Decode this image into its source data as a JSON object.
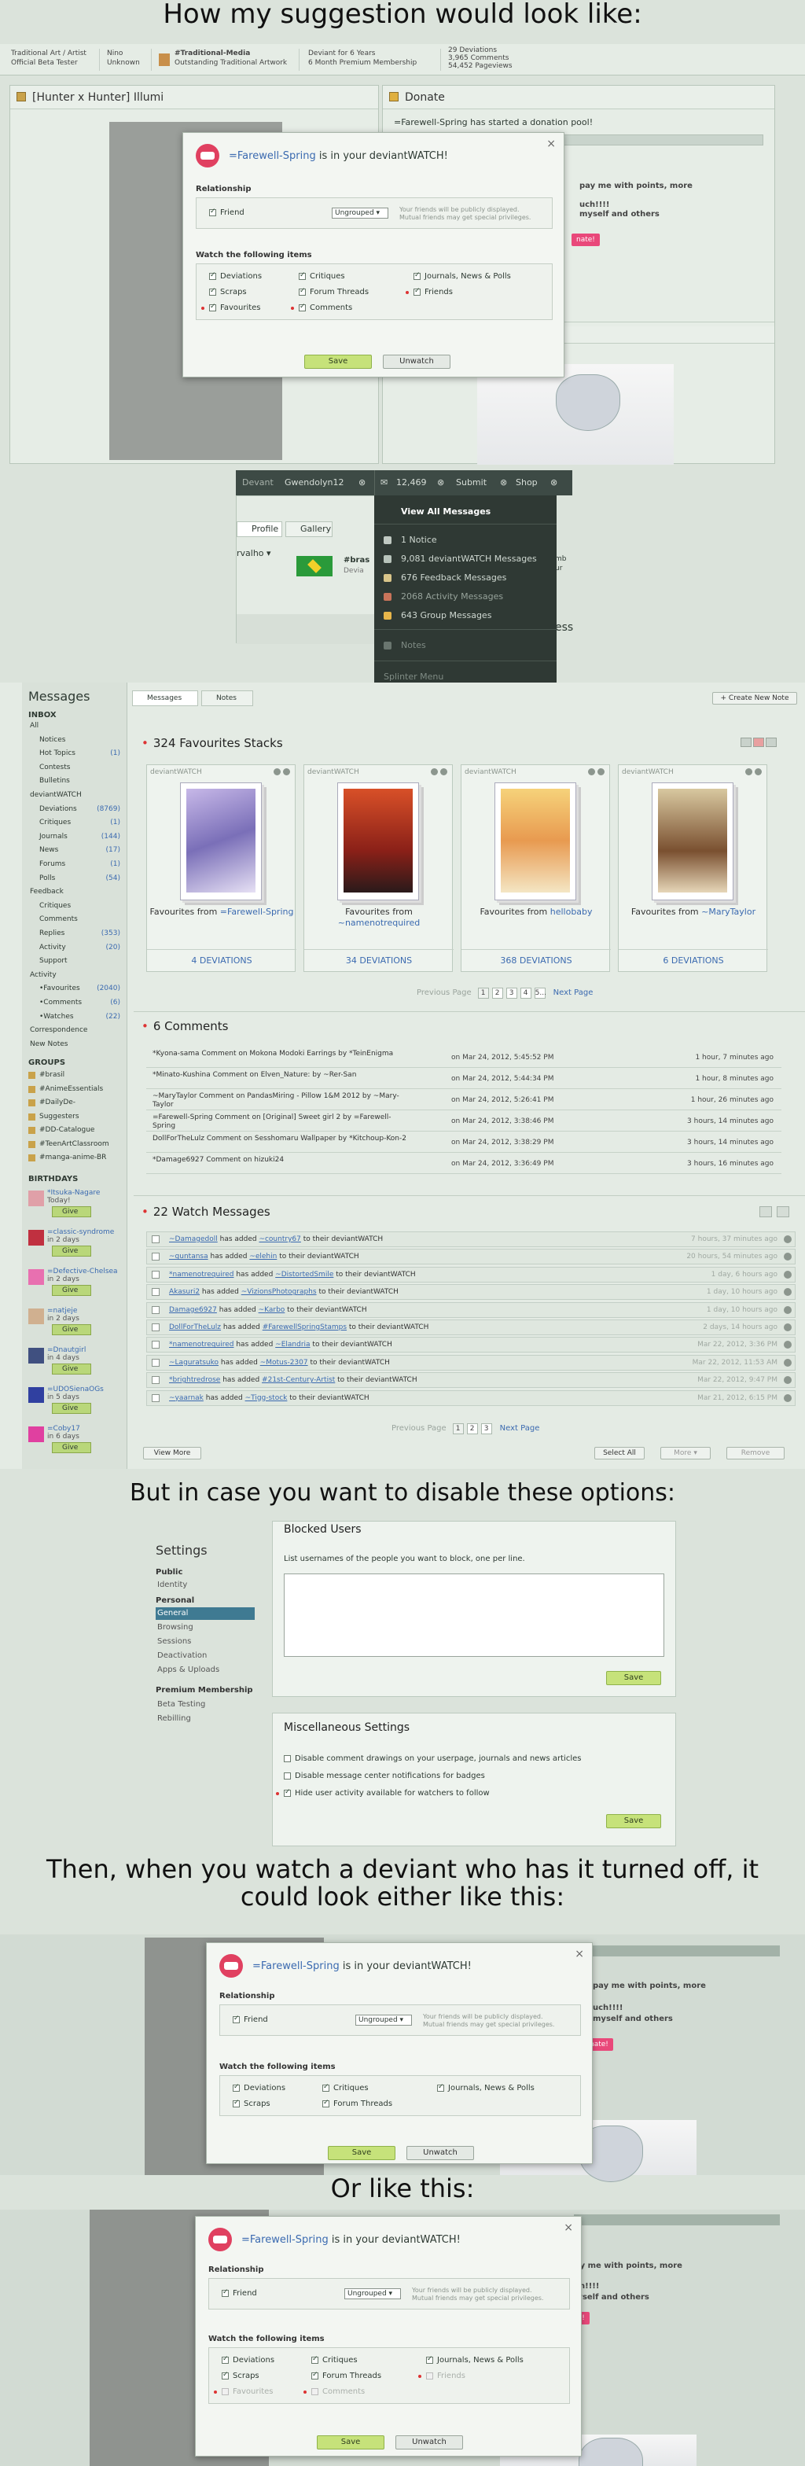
{
  "captions": {
    "c1": "How my suggestion would look  like:",
    "c2": "But in case you want to disable these options:",
    "c3": "Then, when you watch a deviant who has it turned off, it could look either like this:",
    "c4": "Or like this:"
  },
  "topbar": {
    "c1a": "Traditional Art / Artist",
    "c1b": "Official Beta Tester",
    "c2a": "Nino",
    "c2b": "Unknown",
    "c3a": "#Traditional-Media",
    "c3b": "Outstanding Traditional Artwork",
    "c4a": "Deviant for 6 Years",
    "c4b": "6 Month Premium Membership",
    "c5a": "29 Deviations",
    "c5b": "3,965 Comments",
    "c5c": "54,452 Pageviews"
  },
  "left_panel_title": "[Hunter x Hunter] Illumi",
  "donate": {
    "title": "Donate",
    "started": "=Farewell-Spring has started a donation pool!",
    "pay": "pay me with points, more",
    "chlt": "uch!!!!",
    "myself": "myself and others",
    "btn": "nate!"
  },
  "dialog": {
    "close": "×",
    "user": "=Farewell-Spring",
    "suffix": " is in your deviantWATCH!",
    "relationship": "Relationship",
    "friend": "Friend",
    "group": "Ungrouped",
    "hint1": "Your friends will be publicly displayed.",
    "hint2": "Mutual friends may get special privileges.",
    "watch_label": "Watch the following items",
    "deviations": "Deviations",
    "critiques": "Critiques",
    "journals": "Journals, News & Polls",
    "scraps": "Scraps",
    "forum": "Forum Threads",
    "friends": "Friends",
    "favourites": "Favourites",
    "comments": "Comments",
    "save": "Save",
    "unwatch": "Unwatch"
  },
  "nav": {
    "deviant": "Devant",
    "username": "Gwendolyn12",
    "count": "12,469",
    "submit": "Submit",
    "shop": "Shop",
    "profile": "Profile",
    "gallery": "Gallery",
    "valho": "rvalho",
    "bras": "#bras",
    "devi": "Devia",
    "ess": "ess",
    "mb": "mb",
    "ur": "ur"
  },
  "dropdown": {
    "view_all": "View All Messages",
    "notice": "1 Notice",
    "watch": "9,081 deviantWATCH Messages",
    "feedback": "676 Feedback Messages",
    "activity": "2068 Activity Messages",
    "group": "643 Group Messages",
    "notes": "Notes",
    "splinter": "Splinter Menu"
  },
  "messages": {
    "title": "Messages",
    "tab_messages": "Messages",
    "tab_notes": "Notes",
    "create_note": "+ Create New Note",
    "inbox": "INBOX",
    "nav": [
      {
        "label": "All",
        "count": ""
      },
      {
        "label": "Notices",
        "count": ""
      },
      {
        "label": "Hot Topics",
        "count": "(1)"
      },
      {
        "label": "Contests",
        "count": ""
      },
      {
        "label": "Bulletins",
        "count": ""
      },
      {
        "label": "deviantWATCH",
        "count": ""
      },
      {
        "label": "Deviations",
        "count": "(8769)"
      },
      {
        "label": "Critiques",
        "count": "(1)"
      },
      {
        "label": "Journals",
        "count": "(144)"
      },
      {
        "label": "News",
        "count": "(17)"
      },
      {
        "label": "Forums",
        "count": "(1)"
      },
      {
        "label": "Polls",
        "count": "(54)"
      },
      {
        "label": "Feedback",
        "count": ""
      },
      {
        "label": "Critiques",
        "count": ""
      },
      {
        "label": "Comments",
        "count": ""
      },
      {
        "label": "Replies",
        "count": "(353)"
      },
      {
        "label": "Activity",
        "count": "(20)"
      },
      {
        "label": "Support",
        "count": ""
      },
      {
        "label": "Activity",
        "count": ""
      },
      {
        "label": "•Favourites",
        "count": "(2040)"
      },
      {
        "label": "•Comments",
        "count": "(6)"
      },
      {
        "label": "•Watches",
        "count": "(22)"
      },
      {
        "label": "Correspondence",
        "count": ""
      },
      {
        "label": "New Notes",
        "count": ""
      }
    ],
    "groups_h": "GROUPS",
    "groups": [
      "#brasil",
      "#AnimeEssentials",
      "#DailyDe-",
      "Suggesters",
      "#DD-Catalogue",
      "#TeenArtClassroom",
      "#manga-anime-BR"
    ],
    "birthdays_h": "BIRTHDAYS",
    "birthdays": [
      {
        "name": "*Itsuka-Nagare",
        "when": "Today!"
      },
      {
        "name": "=classic-syndrome",
        "when": "in 2 days"
      },
      {
        "name": "=Defective-Chelsea",
        "when": "in 2 days"
      },
      {
        "name": "=natjeje",
        "when": "in 2 days"
      },
      {
        "name": "=Dnautgirl",
        "when": "in 4 days"
      },
      {
        "name": "=UDOSienaOGs",
        "when": "in 5 days"
      },
      {
        "name": "=Coby17",
        "when": "in 6 days"
      }
    ],
    "give": "Give",
    "fav_title": "324 Favourites Stacks",
    "stacks": [
      {
        "label": "deviantWATCH",
        "pre": "Favourites from ",
        "user": "=Farewell-Spring",
        "count": "4 Deviations"
      },
      {
        "label": "deviantWATCH",
        "pre": "Favourites from ",
        "user": "~namenotrequired",
        "count": "34 Deviations"
      },
      {
        "label": "deviantWATCH",
        "pre": "Favourites from ",
        "user": "hellobaby",
        "count": "368 Deviations"
      },
      {
        "label": "deviantWATCH",
        "pre": "Favourites from ",
        "user": "~MaryTaylor",
        "count": "6 Deviations"
      }
    ],
    "prev": "Previous Page",
    "pages": [
      "1",
      "2",
      "3",
      "4",
      "5..."
    ],
    "next": "Next Page",
    "comments_title": "6 Comments",
    "comments": [
      {
        "text": "*Kyona-sama Comment on Mokona Modoki Earrings by *TeinEnigma",
        "date": "on Mar 24, 2012, 5:45:52 PM",
        "ago": "1 hour, 7 minutes ago"
      },
      {
        "text": "*Minato-Kushina Comment on Elven_Nature: by ~Rer-San",
        "date": "on Mar 24, 2012, 5:44:34 PM",
        "ago": "1 hour, 8 minutes ago"
      },
      {
        "text": "~MaryTaylor Comment on PandasMiring - Pillow 1&M 2012 by ~Mary-Taylor",
        "date": "on Mar 24, 2012, 5:26:41 PM",
        "ago": "1 hour, 26 minutes ago"
      },
      {
        "text": "=Farewell-Spring Comment on [Original] Sweet girl 2 by =Farewell-Spring",
        "date": "on Mar 24, 2012, 3:38:46 PM",
        "ago": "3 hours, 14 minutes ago"
      },
      {
        "text": "DollForTheLulz Comment on Sesshomaru Wallpaper by *Kitchoup-Kon-2",
        "date": "on Mar 24, 2012, 3:38:29 PM",
        "ago": "3 hours, 14 minutes ago"
      },
      {
        "text": "*Damage6927 Comment on hizuki24",
        "date": "on Mar 24, 2012, 3:36:49 PM",
        "ago": "3 hours, 16 minutes ago"
      }
    ],
    "watch_title": "22 Watch Messages",
    "watches": [
      {
        "user": "~Damagedoll",
        "target": "~country67",
        "ago": "7 hours, 37 minutes ago"
      },
      {
        "user": "~guntansa",
        "target": "~elehin",
        "ago": "20 hours, 54 minutes ago"
      },
      {
        "user": "*namenotrequired",
        "target": "~DistortedSmile",
        "ago": "1 day, 6 hours ago"
      },
      {
        "user": "Akasuri2",
        "target": "~VizionsPhotographs",
        "ago": "1 day, 10 hours ago"
      },
      {
        "user": "Damage6927",
        "target": "~Karbo",
        "ago": "1 day, 10 hours ago"
      },
      {
        "user": "DollForTheLulz",
        "target": "#FarewellSpringStamps",
        "ago": "2 days, 14 hours ago"
      },
      {
        "user": "*namenotrequired",
        "target": "~Elandria",
        "ago": "Mar 22, 2012, 3:36 PM"
      },
      {
        "user": "~Laguratsuko",
        "target": "~Motus-2307",
        "ago": "Mar 22, 2012, 11:53 AM"
      },
      {
        "user": "*brightredrose",
        "target": "#21st-Century-Artist",
        "ago": "Mar 22, 2012, 9:47 PM"
      },
      {
        "user": "~yaarnak",
        "target": "~Tigg-stock",
        "ago": "Mar 21, 2012, 6:15 PM"
      }
    ],
    "has_added": " has added ",
    "to_watch": " to their deviantWATCH",
    "watch_pages": [
      "1",
      "2",
      "3"
    ],
    "view_more": "View More",
    "select_all": "Select All",
    "more": "More ▾",
    "remove": "Remove"
  },
  "settings": {
    "title": "Settings",
    "public": "Public",
    "identity": "Identity",
    "personal": "Personal",
    "general": "General",
    "browsing": "Browsing",
    "sessions": "Sessions",
    "deactivation": "Deactivation",
    "apps": "Apps & Uploads",
    "premium": "Premium Membership",
    "beta": "Beta Testing",
    "rebilling": "Rebilling",
    "blocked_title": "Blocked Users",
    "blocked_desc": "List usernames of the people you want to block, one per line.",
    "save": "Save",
    "misc_title": "Miscellaneous Settings",
    "opt1": "Disable comment drawings on your userpage, journals and news articles",
    "opt2": "Disable message center notifications for badges",
    "opt3": "Hide user activity available for watchers to follow"
  }
}
